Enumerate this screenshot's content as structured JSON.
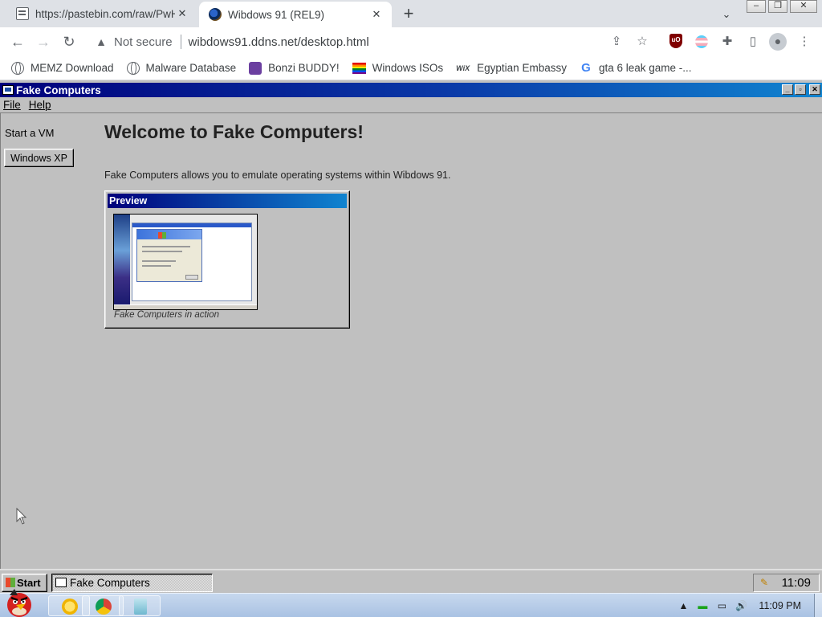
{
  "browser": {
    "tabs": [
      {
        "title": "https://pastebin.com/raw/PwHx",
        "active": false
      },
      {
        "title": "Wibdows 91 (REL9)",
        "active": true
      }
    ],
    "security_label": "Not secure",
    "url": "wibdows91.ddns.net/desktop.html",
    "bookmarks": [
      {
        "label": "MEMZ Download",
        "icon": "globe-icon"
      },
      {
        "label": "Malware Database",
        "icon": "globe-icon"
      },
      {
        "label": "Bonzi BUDDY!",
        "icon": "bonzi-icon"
      },
      {
        "label": "Windows ISOs",
        "icon": "rainbow-flag-icon"
      },
      {
        "label": "Egyptian Embassy",
        "icon": "wix-icon"
      },
      {
        "label": "gta 6 leak game -...",
        "icon": "google-icon"
      }
    ]
  },
  "app": {
    "window_title": "Fake Computers",
    "menu": {
      "file": "File",
      "help": "Help"
    },
    "sidebar": {
      "label": "Start a VM",
      "vm_button": "Windows XP"
    },
    "main": {
      "heading": "Welcome to Fake Computers!",
      "description": "Fake Computers allows you to emulate operating systems within Wibdows 91.",
      "preview_title": "Preview",
      "preview_caption": "Fake Computers in action"
    }
  },
  "taskbar": {
    "start_label": "Start",
    "task_label": "Fake Computers",
    "clock": "11:09"
  },
  "host_taskbar": {
    "clock": "11:09 PM"
  },
  "colors": {
    "titlebar_start": "#00007b",
    "titlebar_end": "#1084d0",
    "desktop": "#c0c0c0"
  }
}
